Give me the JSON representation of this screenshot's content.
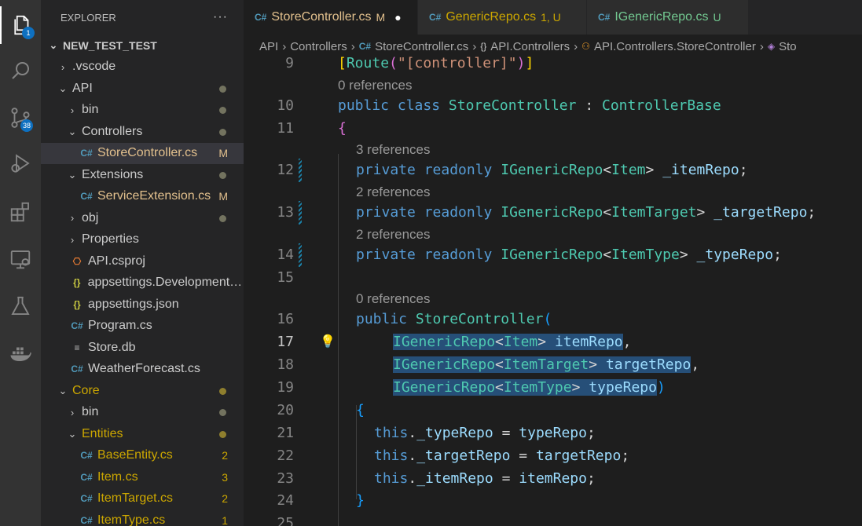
{
  "activity_bar": {
    "explorer_badge": "1",
    "scm_badge": "38"
  },
  "explorer": {
    "title": "EXPLORER",
    "more": "···",
    "root": "NEW_TEST_TEST",
    "items": [
      {
        "label": ".vscode",
        "kind": "folder-closed",
        "depth": 1
      },
      {
        "label": "API",
        "kind": "folder-open",
        "depth": 1,
        "dot": "gray"
      },
      {
        "label": "bin",
        "kind": "folder-closed",
        "depth": 2,
        "dot": "gray"
      },
      {
        "label": "Controllers",
        "kind": "folder-open",
        "depth": 2,
        "dot": "gray"
      },
      {
        "label": "StoreController.cs",
        "kind": "cs",
        "depth": 3,
        "badge": "M",
        "selected": true
      },
      {
        "label": "Extensions",
        "kind": "folder-open",
        "depth": 2,
        "dot": "gray"
      },
      {
        "label": "ServiceExtension.cs",
        "kind": "cs",
        "depth": 3,
        "badge": "M"
      },
      {
        "label": "obj",
        "kind": "folder-closed",
        "depth": 2,
        "dot": "gray"
      },
      {
        "label": "Properties",
        "kind": "folder-closed",
        "depth": 2
      },
      {
        "label": "API.csproj",
        "kind": "xml",
        "depth": 2
      },
      {
        "label": "appsettings.Development.j...",
        "kind": "json",
        "depth": 2
      },
      {
        "label": "appsettings.json",
        "kind": "json",
        "depth": 2
      },
      {
        "label": "Program.cs",
        "kind": "cs",
        "depth": 2
      },
      {
        "label": "Store.db",
        "kind": "db",
        "depth": 2
      },
      {
        "label": "WeatherForecast.cs",
        "kind": "cs",
        "depth": 2
      },
      {
        "label": "Core",
        "kind": "folder-open",
        "depth": 1,
        "dot": "orange",
        "warn": true
      },
      {
        "label": "bin",
        "kind": "folder-closed",
        "depth": 2,
        "dot": "gray"
      },
      {
        "label": "Entities",
        "kind": "folder-open",
        "depth": 2,
        "dot": "orange",
        "warn": true
      },
      {
        "label": "BaseEntity.cs",
        "kind": "cs",
        "depth": 3,
        "badge": "2",
        "warn": true
      },
      {
        "label": "Item.cs",
        "kind": "cs",
        "depth": 3,
        "badge": "3",
        "warn": true
      },
      {
        "label": "ItemTarget.cs",
        "kind": "cs",
        "depth": 3,
        "badge": "2",
        "warn": true
      },
      {
        "label": "ItemType.cs",
        "kind": "cs",
        "depth": 3,
        "badge": "1",
        "warn": true
      }
    ]
  },
  "tabs": [
    {
      "label": "StoreController.cs",
      "status": "M",
      "active": true,
      "dirty": "●",
      "color": "#e2c08d"
    },
    {
      "label": "GenericRepo.cs",
      "status": "1, U",
      "active": false,
      "color": "#cca700"
    },
    {
      "label": "IGenericRepo.cs",
      "status": "U",
      "active": false,
      "color": "#73c991"
    }
  ],
  "breadcrumb": [
    "API",
    "Controllers",
    "StoreController.cs",
    "API.Controllers",
    "API.Controllers.StoreController",
    "Sto"
  ],
  "editor": {
    "line_numbers": [
      "9",
      "10",
      "11",
      "12",
      "13",
      "14",
      "15",
      "16",
      "17",
      "18",
      "19",
      "20",
      "21",
      "22",
      "23",
      "24",
      "25"
    ],
    "codelens": [
      "0 references",
      "3 references",
      "2 references",
      "2 references",
      "0 references"
    ],
    "code": {
      "route_attr": "[Route(\"[controller]\")]",
      "l10": [
        "public",
        "class",
        "StoreController",
        ":",
        "ControllerBase"
      ],
      "l11": "{",
      "l12": [
        "private",
        "readonly",
        "IGenericRepo",
        "Item",
        "_itemRepo"
      ],
      "l13": [
        "private",
        "readonly",
        "IGenericRepo",
        "ItemTarget",
        "_targetRepo"
      ],
      "l14": [
        "private",
        "readonly",
        "IGenericRepo",
        "ItemType",
        "_typeRepo"
      ],
      "l16": [
        "public",
        "StoreController"
      ],
      "l17": [
        "IGenericRepo",
        "Item",
        "itemRepo"
      ],
      "l18": [
        "IGenericRepo",
        "ItemTarget",
        "targetRepo"
      ],
      "l19": [
        "IGenericRepo",
        "ItemType",
        "typeRepo"
      ],
      "l20": "{",
      "l21": [
        "this",
        "_typeRepo",
        "typeRepo"
      ],
      "l22": [
        "this",
        "_targetRepo",
        "targetRepo"
      ],
      "l23": [
        "this",
        "_itemRepo",
        "itemRepo"
      ],
      "l24": "}"
    }
  }
}
